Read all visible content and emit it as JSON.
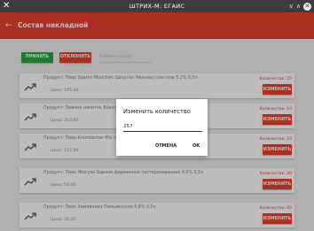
{
  "window": {
    "title": "ШТРИХ-М: ЕГАИС",
    "close_glyph": "✕",
    "minimize_glyph": "∨",
    "maximize_glyph": "∧",
    "close_button_glyph": "✕"
  },
  "appbar": {
    "title": "Состав накладной",
    "back_glyph": "←"
  },
  "actions": {
    "accept_label": "ПРИНЯТЬ",
    "reject_label": "ОТКЛОНИТЬ",
    "comment_placeholder": "Комментарий"
  },
  "items": [
    {
      "product": "Продукт: Пиво Spaten Munchen (Шпатен Мюнхен) светлое 5,2% 0,5л",
      "price": "Цена: 145.00",
      "quantity": "Количество: 25",
      "change_label": "ИЗМЕНИТЬ"
    },
    {
      "product": "Продукт: Пивной напиток Blanche",
      "price": "Цена: 203.00",
      "quantity": "Количество: 10",
      "change_label": "ИЗМЕНИТЬ"
    },
    {
      "product": "Продукт: Пиво Krombacher Pils (К",
      "price": "Цена: 137.00",
      "quantity": "Количество: 10",
      "change_label": "ИЗМЕНИТЬ"
    },
    {
      "product": "Продукт: Пиво Жигули Барное фирменное пастеризованное 4,9% 0,5л",
      "price": "Цена: 54.00",
      "quantity": "Количество: 40",
      "change_label": "ИЗМЕНИТЬ"
    },
    {
      "product": "Продукт: Пиво Хамовники Пильзенское 4,8% 0,5л",
      "price": "Цена: 56.35",
      "quantity": "Количество: 60",
      "change_label": "ИЗМЕНИТЬ"
    }
  ],
  "dialog": {
    "title": "Изменить количество",
    "value": "257",
    "cancel_label": "ОТМЕНА",
    "ok_label": "ОК"
  },
  "colors": {
    "accent": "#e8412c",
    "accept": "#27a543",
    "titlebar": "#3c3c3c"
  }
}
